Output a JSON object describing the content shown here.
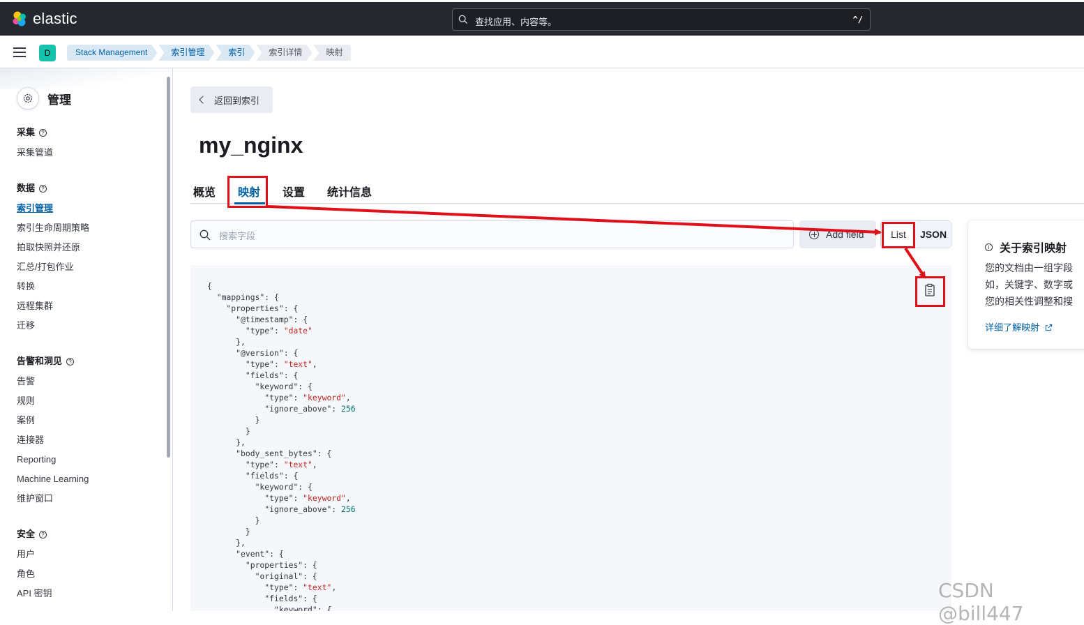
{
  "header": {
    "brand": "elastic",
    "search_placeholder": "查找应用、内容等。",
    "search_shortcut": "^/"
  },
  "space": {
    "initial": "D"
  },
  "breadcrumbs": [
    "Stack Management",
    "索引管理",
    "索引",
    "索引详情",
    "映射"
  ],
  "sidebar": {
    "title": "管理",
    "groups": [
      {
        "title": "采集",
        "items": [
          "采集管道"
        ]
      },
      {
        "title": "数据",
        "items": [
          "索引管理",
          "索引生命周期策略",
          "拍取快照并还原",
          "汇总/打包作业",
          "转换",
          "远程集群",
          "迁移"
        ]
      },
      {
        "title": "告警和洞见",
        "items": [
          "告警",
          "规则",
          "案例",
          "连接器",
          "Reporting",
          "Machine Learning",
          "维护窗口"
        ]
      },
      {
        "title": "安全",
        "items": [
          "用户",
          "角色",
          "API 密钥"
        ]
      }
    ]
  },
  "main": {
    "back_label": "返回到索引",
    "title": "my_nginx",
    "tabs": [
      "概览",
      "映射",
      "设置",
      "统计信息"
    ],
    "active_tab": "映射",
    "field_search_placeholder": "搜索字段",
    "add_field_label": "Add field",
    "view_toggle": [
      "List",
      "JSON"
    ],
    "selected_view": "JSON"
  },
  "mapping_json": [
    "{",
    "  \"mappings\": {",
    "    \"properties\": {",
    "      \"@timestamp\": {",
    "        \"type\": \"date\"",
    "      },",
    "      \"@version\": {",
    "        \"type\": \"text\",",
    "        \"fields\": {",
    "          \"keyword\": {",
    "            \"type\": \"keyword\",",
    "            \"ignore_above\": 256",
    "          }",
    "        }",
    "      },",
    "      \"body_sent_bytes\": {",
    "        \"type\": \"text\",",
    "        \"fields\": {",
    "          \"keyword\": {",
    "            \"type\": \"keyword\",",
    "            \"ignore_above\": 256",
    "          }",
    "        }",
    "      },",
    "      \"event\": {",
    "        \"properties\": {",
    "          \"original\": {",
    "            \"type\": \"text\",",
    "            \"fields\": {",
    "              \"keyword\": {"
  ],
  "info_card": {
    "title": "关于索引映射",
    "lines": [
      "您的文档由一组字段",
      "如，关键字、数字或",
      "您的相关性调整和搜"
    ],
    "link": "详细了解映射"
  },
  "watermark": "CSDN @bill447",
  "colors": {
    "header_bg": "#25282f",
    "accent": "#0061a6",
    "annotation_red": "#e0101a",
    "space_badge": "#15c3ad"
  }
}
